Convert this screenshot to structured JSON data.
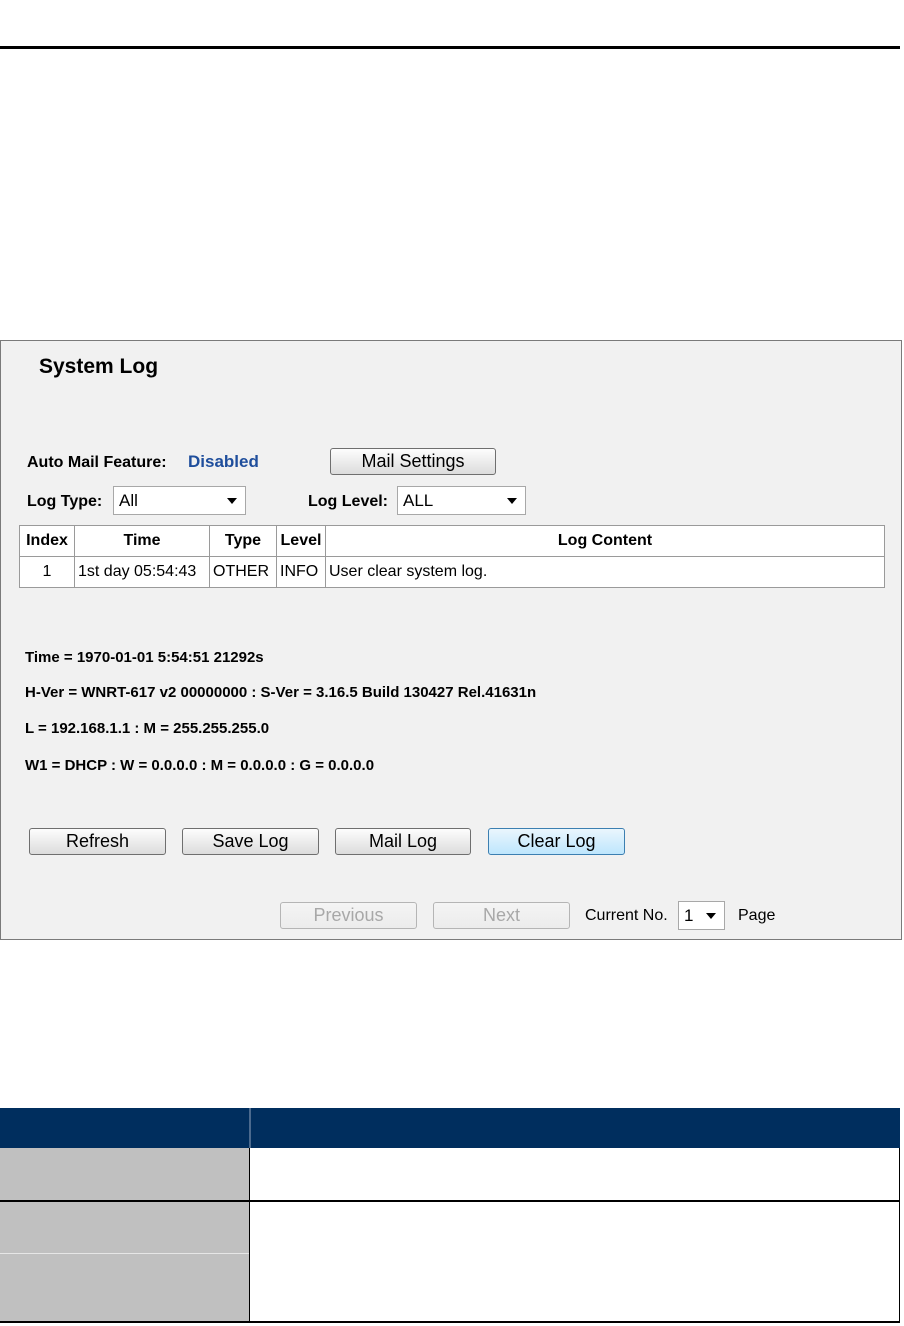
{
  "panel": {
    "title": "System Log",
    "auto_mail": {
      "label": "Auto Mail Feature:",
      "value": "Disabled",
      "value_color": "#1f4e9c"
    },
    "mail_settings_label": "Mail Settings",
    "log_type": {
      "label": "Log Type:",
      "selected": "All"
    },
    "log_level": {
      "label": "Log Level:",
      "selected": "ALL"
    },
    "table": {
      "headers": [
        "Index",
        "Time",
        "Type",
        "Level",
        "Log Content"
      ],
      "rows": [
        [
          "1",
          "1st day 05:54:43",
          "OTHER",
          "INFO",
          "User clear system log."
        ]
      ]
    },
    "info_lines": [
      "Time = 1970-01-01 5:54:51 21292s",
      "H-Ver = WNRT-617 v2 00000000 : S-Ver = 3.16.5 Build 130427 Rel.41631n",
      "L = 192.168.1.1 : M = 255.255.255.0",
      "W1 = DHCP : W = 0.0.0.0 : M = 0.0.0.0 : G = 0.0.0.0"
    ],
    "buttons": {
      "refresh": "Refresh",
      "save_log": "Save Log",
      "mail_log": "Mail Log",
      "clear_log": "Clear Log"
    },
    "pagination": {
      "previous": "Previous",
      "next": "Next",
      "current_label": "Current No.",
      "current_value": "1",
      "page_label": "Page"
    }
  },
  "colors": {
    "doc_header": "#002e5e",
    "doc_gray": "#c0c0c0",
    "panel_bg": "#f1f1f1"
  }
}
